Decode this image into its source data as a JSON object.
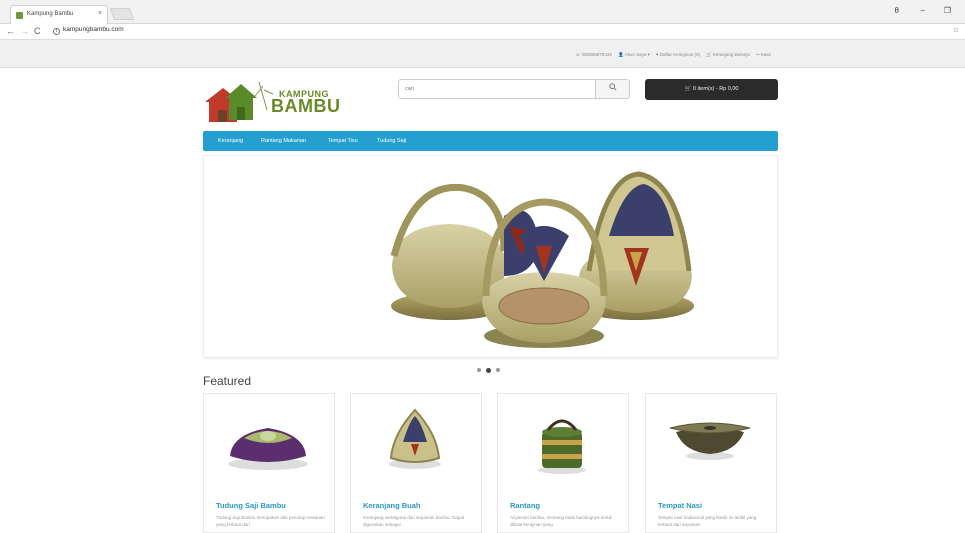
{
  "browser": {
    "tab_title": "Kampung Bambu",
    "tab_close": "×",
    "url": "kampungbambu.com",
    "window_controls": [
      "θ",
      "–",
      "❐"
    ]
  },
  "topbar": {
    "links": [
      "083856878432",
      "Akun Saya ▾",
      "Daftar Keinginan (0)",
      "Keranjang Belanja",
      "Kasir"
    ]
  },
  "logo": {
    "line1": "KAMPUNG",
    "line2": "BAMBU"
  },
  "search": {
    "placeholder": "cari",
    "button_icon": "search-icon"
  },
  "cart": {
    "label": "0 item(s) - Rp 0,00"
  },
  "menu": {
    "items": [
      "Keranjang",
      "Rantang Makanan",
      "Tempat Tisu",
      "Tudung Saji"
    ]
  },
  "featured": {
    "heading": "Featured",
    "products": [
      {
        "title": "Tudung Saji Bambu",
        "desc": "Tudung Saji Bambu merupakan alat penutup makanan yang terbuat dari"
      },
      {
        "title": "Keranjang Buah",
        "desc": "Keranjang serbaguna dari anyaman bambu. Dapat digunakan sebagai"
      },
      {
        "title": "Rantang",
        "desc": "Anyaman bambu, memang tiada bandingnya untuk dibuat kerajinan yang"
      },
      {
        "title": "Tempat Nasi",
        "desc": "Tempat nasi tradisional yang klasik ini ambil yang terbuat dari anyaman"
      }
    ]
  },
  "colors": {
    "menu_bar": "#24a0d0",
    "cart_bg": "#2b2b2b",
    "product_title": "#2a98c7",
    "logo_green": "#6a8a2a"
  }
}
